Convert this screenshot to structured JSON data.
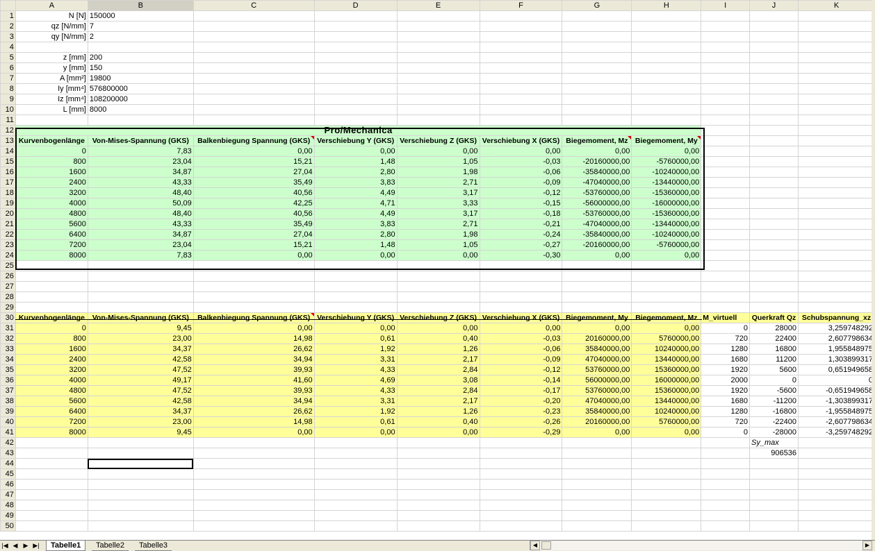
{
  "columns": [
    "A",
    "B",
    "C",
    "D",
    "E",
    "F",
    "G",
    "H",
    "I",
    "J",
    "K"
  ],
  "params": [
    {
      "row": 1,
      "label": "N  [N]",
      "value": "150000"
    },
    {
      "row": 2,
      "label": "qz  [N/mm]",
      "value": "7"
    },
    {
      "row": 3,
      "label": "qy  [N/mm]",
      "value": "2"
    },
    {
      "row": 5,
      "label": "z  [mm]",
      "value": "200"
    },
    {
      "row": 6,
      "label": "y  [mm]",
      "value": "150"
    },
    {
      "row": 7,
      "label": "A  [mm²]",
      "value": "19800"
    },
    {
      "row": 8,
      "label": "Iy   [mm⁴]",
      "value": "576800000"
    },
    {
      "row": 9,
      "label": "Iz   [mm⁴]",
      "value": "108200000"
    },
    {
      "row": 10,
      "label": "L  [mm]",
      "value": "8000"
    }
  ],
  "green_table": {
    "title": "Pro/Mechanica",
    "headers": [
      "Kurvenbogenlänge",
      "Von-Mises-Spannung (GKS)",
      "Balkenbiegung Spannung (GKS)",
      "Verschiebung Y (GKS)",
      "Verschiebung Z (GKS)",
      "Verschiebung X (GKS)",
      "Biegemoment, Mz",
      "Biegemoment, My"
    ],
    "rows": [
      [
        "0",
        "7,83",
        "0,00",
        "0,00",
        "0,00",
        "0,00",
        "0,00",
        "0,00"
      ],
      [
        "800",
        "23,04",
        "15,21",
        "1,48",
        "1,05",
        "-0,03",
        "-20160000,00",
        "-5760000,00"
      ],
      [
        "1600",
        "34,87",
        "27,04",
        "2,80",
        "1,98",
        "-0,06",
        "-35840000,00",
        "-10240000,00"
      ],
      [
        "2400",
        "43,33",
        "35,49",
        "3,83",
        "2,71",
        "-0,09",
        "-47040000,00",
        "-13440000,00"
      ],
      [
        "3200",
        "48,40",
        "40,56",
        "4,49",
        "3,17",
        "-0,12",
        "-53760000,00",
        "-15360000,00"
      ],
      [
        "4000",
        "50,09",
        "42,25",
        "4,71",
        "3,33",
        "-0,15",
        "-56000000,00",
        "-16000000,00"
      ],
      [
        "4800",
        "48,40",
        "40,56",
        "4,49",
        "3,17",
        "-0,18",
        "-53760000,00",
        "-15360000,00"
      ],
      [
        "5600",
        "43,33",
        "35,49",
        "3,83",
        "2,71",
        "-0,21",
        "-47040000,00",
        "-13440000,00"
      ],
      [
        "6400",
        "34,87",
        "27,04",
        "2,80",
        "1,98",
        "-0,24",
        "-35840000,00",
        "-10240000,00"
      ],
      [
        "7200",
        "23,04",
        "15,21",
        "1,48",
        "1,05",
        "-0,27",
        "-20160000,00",
        "-5760000,00"
      ],
      [
        "8000",
        "7,83",
        "0,00",
        "0,00",
        "0,00",
        "-0,30",
        "0,00",
        "0,00"
      ]
    ]
  },
  "yellow_table": {
    "headers": [
      "Kurvenbogenlänge",
      "Von-Mises-Spannung (GKS)",
      "Balkenbiegung Spannung (GKS)",
      "Verschiebung Y (GKS)",
      "Verschiebung Z (GKS)",
      "Verschiebung X (GKS)",
      "Biegemoment, My",
      "Biegemoment, Mz"
    ],
    "extra_headers": [
      "M_virtuell",
      "Querkraft Qz",
      "Schubspannung_xz"
    ],
    "rows": [
      [
        "0",
        "9,45",
        "0,00",
        "0,00",
        "0,00",
        "0,00",
        "0,00",
        "0,00"
      ],
      [
        "800",
        "23,00",
        "14,98",
        "0,61",
        "0,40",
        "-0,03",
        "20160000,00",
        "5760000,00"
      ],
      [
        "1600",
        "34,37",
        "26,62",
        "1,92",
        "1,26",
        "-0,06",
        "35840000,00",
        "10240000,00"
      ],
      [
        "2400",
        "42,58",
        "34,94",
        "3,31",
        "2,17",
        "-0,09",
        "47040000,00",
        "13440000,00"
      ],
      [
        "3200",
        "47,52",
        "39,93",
        "4,33",
        "2,84",
        "-0,12",
        "53760000,00",
        "15360000,00"
      ],
      [
        "4000",
        "49,17",
        "41,60",
        "4,69",
        "3,08",
        "-0,14",
        "56000000,00",
        "16000000,00"
      ],
      [
        "4800",
        "47,52",
        "39,93",
        "4,33",
        "2,84",
        "-0,17",
        "53760000,00",
        "15360000,00"
      ],
      [
        "5600",
        "42,58",
        "34,94",
        "3,31",
        "2,17",
        "-0,20",
        "47040000,00",
        "13440000,00"
      ],
      [
        "6400",
        "34,37",
        "26,62",
        "1,92",
        "1,26",
        "-0,23",
        "35840000,00",
        "10240000,00"
      ],
      [
        "7200",
        "23,00",
        "14,98",
        "0,61",
        "0,40",
        "-0,26",
        "20160000,00",
        "5760000,00"
      ],
      [
        "8000",
        "9,45",
        "0,00",
        "0,00",
        "0,00",
        "-0,29",
        "0,00",
        "0,00"
      ]
    ],
    "extra_rows": [
      [
        "0",
        "28000",
        "3,259748292"
      ],
      [
        "720",
        "22400",
        "2,607798634"
      ],
      [
        "1280",
        "16800",
        "1,955848975"
      ],
      [
        "1680",
        "11200",
        "1,303899317"
      ],
      [
        "1920",
        "5600",
        "0,651949658"
      ],
      [
        "2000",
        "0",
        "0"
      ],
      [
        "1920",
        "-5600",
        "-0,651949658"
      ],
      [
        "1680",
        "-11200",
        "-1,303899317"
      ],
      [
        "1280",
        "-16800",
        "-1,955848975"
      ],
      [
        "720",
        "-22400",
        "-2,607798634"
      ],
      [
        "0",
        "-28000",
        "-3,259748292"
      ]
    ]
  },
  "sy_max": {
    "label": "Sy_max",
    "value": "906536"
  },
  "selected_cell": "B44",
  "sheet_tabs": [
    {
      "label": "Tabelle1",
      "active": true
    },
    {
      "label": "Tabelle2",
      "active": false
    },
    {
      "label": "Tabelle3",
      "active": false
    }
  ],
  "nav_buttons": [
    "|◀",
    "◀",
    "▶",
    "▶|"
  ],
  "colors": {
    "green": "#ccffcc",
    "yellow": "#ffff99",
    "header_bg": "#ece9d8"
  }
}
